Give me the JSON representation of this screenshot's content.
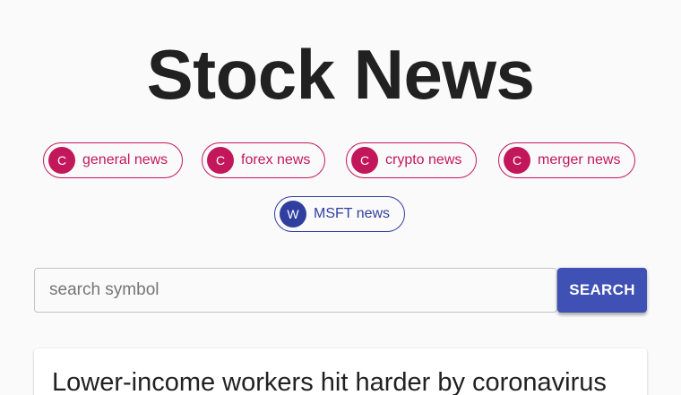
{
  "header": {
    "title": "Stock News"
  },
  "categories": [
    {
      "avatar": "C",
      "label": "general news"
    },
    {
      "avatar": "C",
      "label": "forex news"
    },
    {
      "avatar": "C",
      "label": "crypto news"
    },
    {
      "avatar": "C",
      "label": "merger news"
    }
  ],
  "watchlist": [
    {
      "avatar": "W",
      "label": "MSFT news"
    }
  ],
  "search": {
    "placeholder": "search symbol",
    "value": "",
    "button_label": "SEARCH"
  },
  "articles": [
    {
      "title": "Lower-income workers hit harder by coronavirus"
    }
  ],
  "colors": {
    "category_chip": "#c2185b",
    "watchlist_chip": "#303f9f",
    "primary_button": "#3f51b5",
    "background": "#fafafa"
  }
}
